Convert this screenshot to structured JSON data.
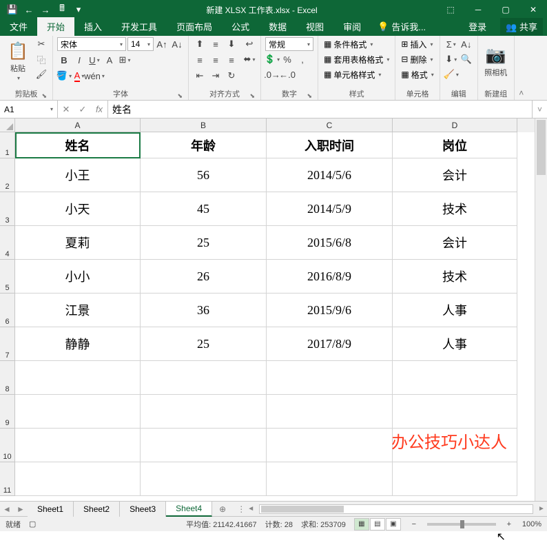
{
  "title": "新建 XLSX 工作表.xlsx - Excel",
  "qat": [
    "💾",
    "←",
    "→",
    "🖩"
  ],
  "tabs": {
    "file": "文件",
    "home": "开始",
    "insert": "插入",
    "dev": "开发工具",
    "layout": "页面布局",
    "formula": "公式",
    "data": "数据",
    "view": "视图",
    "review": "审阅",
    "tellme": "告诉我...",
    "login": "登录",
    "share": "共享"
  },
  "ribbon": {
    "clipboard": {
      "paste": "粘贴",
      "label": "剪贴板"
    },
    "font": {
      "name": "宋体",
      "size": "14",
      "label": "字体"
    },
    "align": {
      "label": "对齐方式"
    },
    "number": {
      "general": "常规",
      "label": "数字"
    },
    "styles": {
      "cond": "条件格式",
      "table": "套用表格格式",
      "cell": "单元格样式",
      "label": "样式"
    },
    "cells": {
      "insert": "插入",
      "delete": "删除",
      "format": "格式",
      "label": "单元格"
    },
    "editing": {
      "label": "编辑"
    },
    "camera": {
      "label": "照相机",
      "group": "新建组"
    }
  },
  "namebox": "A1",
  "formula": "姓名",
  "cols": [
    "A",
    "B",
    "C",
    "D"
  ],
  "rows": [
    {
      "n": "1",
      "h": "rh-1",
      "cells": [
        "姓名",
        "年龄",
        "入职时间",
        "岗位"
      ],
      "header": true
    },
    {
      "n": "2",
      "h": "rh-d",
      "cells": [
        "小王",
        "56",
        "2014/5/6",
        "会计"
      ]
    },
    {
      "n": "3",
      "h": "rh-d",
      "cells": [
        "小天",
        "45",
        "2014/5/9",
        "技术"
      ]
    },
    {
      "n": "4",
      "h": "rh-d",
      "cells": [
        "夏莉",
        "25",
        "2015/6/8",
        "会计"
      ]
    },
    {
      "n": "5",
      "h": "rh-d",
      "cells": [
        "小小",
        "26",
        "2016/8/9",
        "技术"
      ]
    },
    {
      "n": "6",
      "h": "rh-d",
      "cells": [
        "江景",
        "36",
        "2015/9/6",
        "人事"
      ]
    },
    {
      "n": "7",
      "h": "rh-d",
      "cells": [
        "静静",
        "25",
        "2017/8/9",
        "人事"
      ]
    },
    {
      "n": "8",
      "h": "rh-d",
      "cells": [
        "",
        "",
        "",
        ""
      ]
    },
    {
      "n": "9",
      "h": "rh-d",
      "cells": [
        "",
        "",
        "",
        ""
      ]
    },
    {
      "n": "10",
      "h": "rh-d",
      "cells": [
        "",
        "",
        "",
        ""
      ]
    },
    {
      "n": "11",
      "h": "rh-d",
      "cells": [
        "",
        "",
        "",
        ""
      ]
    }
  ],
  "watermark": "办公技巧小达人",
  "sheets": [
    "Sheet1",
    "Sheet2",
    "Sheet3",
    "Sheet4"
  ],
  "activeSheet": 3,
  "status": {
    "ready": "就绪",
    "avg_l": "平均值:",
    "avg": "21142.41667",
    "count_l": "计数:",
    "count": "28",
    "sum_l": "求和:",
    "sum": "253709",
    "zoom": "100%"
  }
}
